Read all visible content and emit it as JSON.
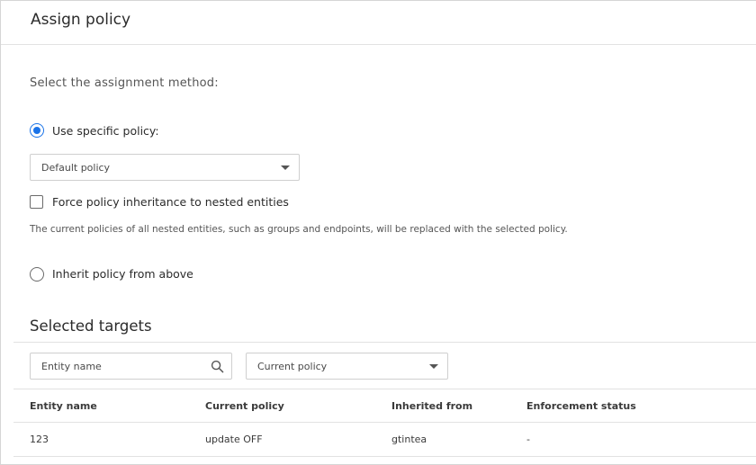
{
  "dialog": {
    "title": "Assign policy"
  },
  "assignment": {
    "method_label": "Select the assignment method:",
    "option_specific": {
      "label": "Use specific policy:",
      "checked": true
    },
    "policy_select": {
      "value": "Default policy"
    },
    "force_inheritance": {
      "label": "Force policy inheritance to nested entities",
      "checked": false
    },
    "help_text": "The current policies of all nested entities, such as groups and endpoints, will be replaced with the selected policy.",
    "option_inherit": {
      "label": "Inherit policy from above",
      "checked": false
    }
  },
  "targets": {
    "title": "Selected targets",
    "search": {
      "placeholder": "Entity name",
      "icon": "search-icon"
    },
    "policy_filter": {
      "value": "Current policy"
    },
    "columns": [
      "Entity name",
      "Current policy",
      "Inherited from",
      "Enforcement status"
    ],
    "rows": [
      {
        "entity": "123",
        "policy": "update OFF",
        "inherited": "gtintea",
        "status": "-"
      }
    ]
  },
  "colors": {
    "accent": "#1a73e8",
    "border": "#cfcfcf",
    "divider": "#e2e2e2"
  }
}
